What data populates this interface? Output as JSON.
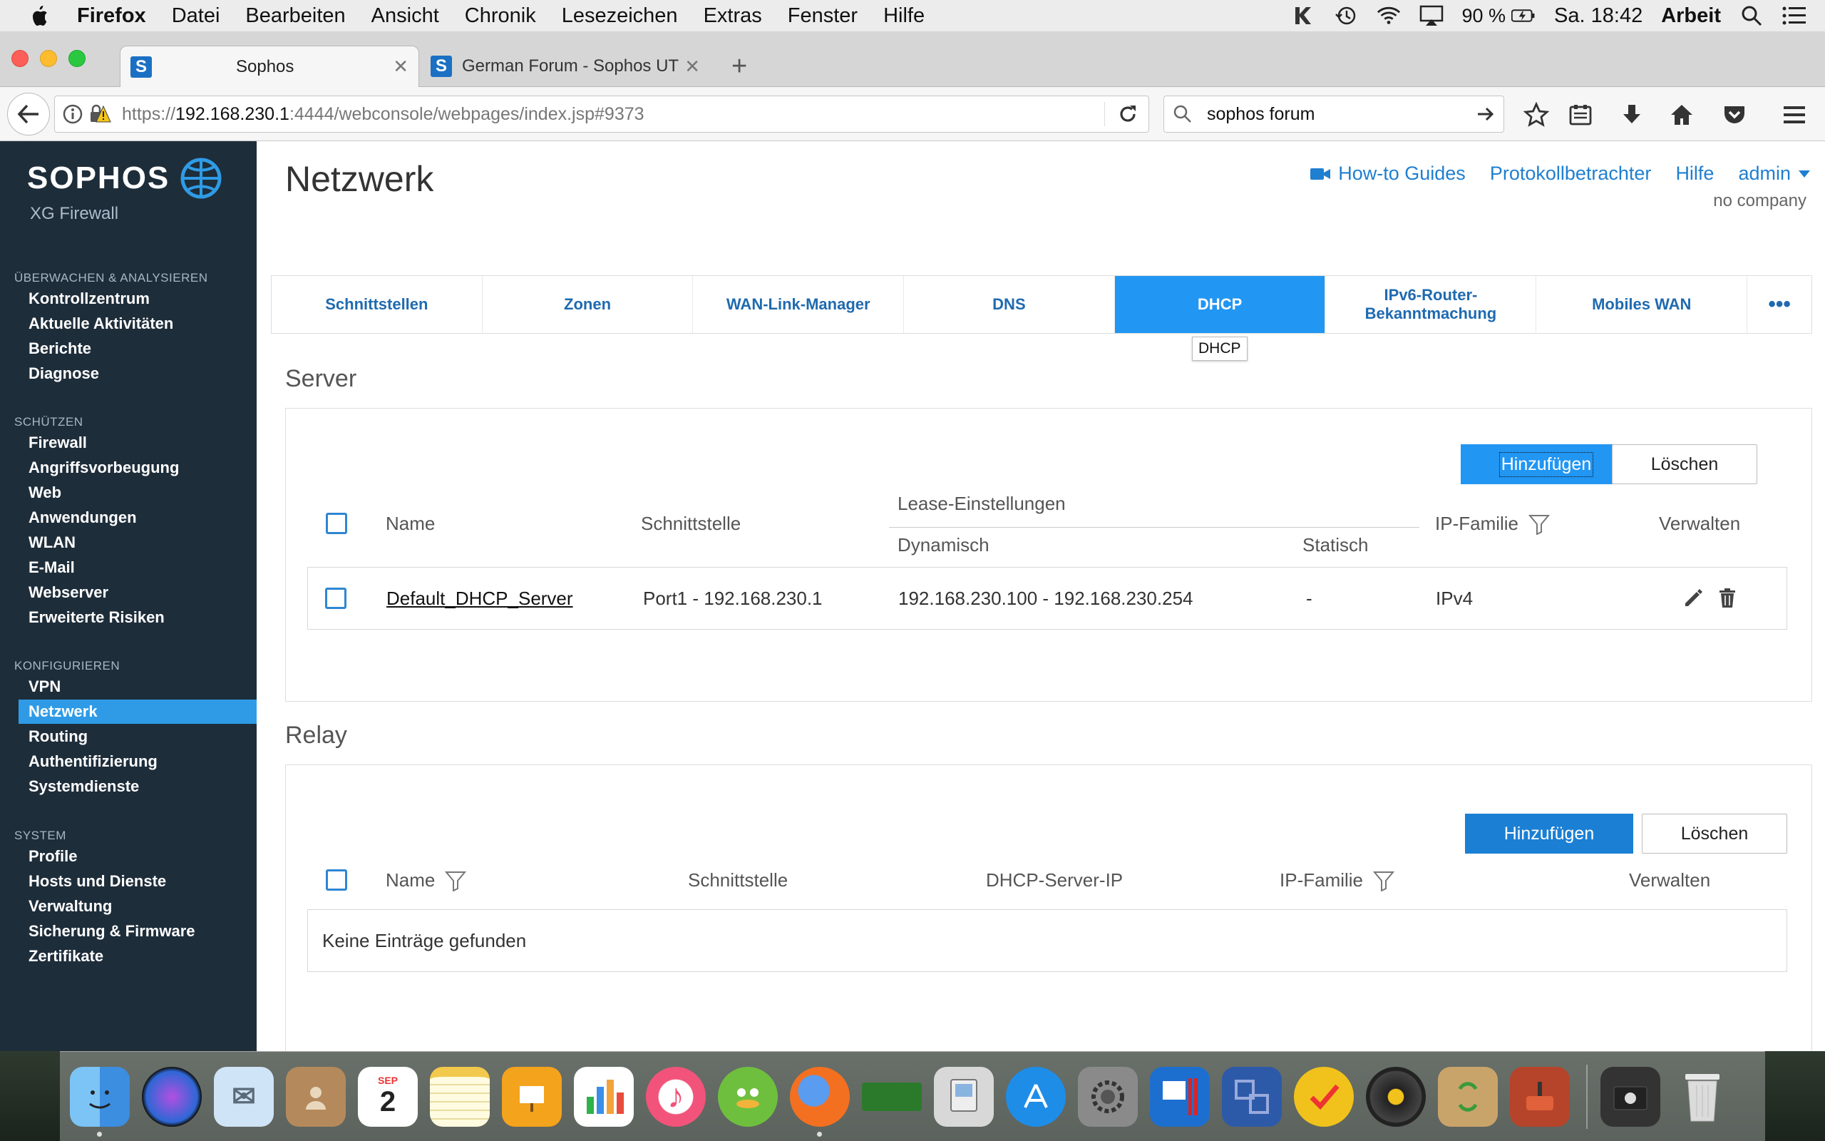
{
  "menubar": {
    "app": "Firefox",
    "items": [
      "Datei",
      "Bearbeiten",
      "Ansicht",
      "Chronik",
      "Lesezeichen",
      "Extras",
      "Fenster",
      "Hilfe"
    ],
    "battery": "90 %",
    "clock": "Sa. 18:42",
    "user": "Arbeit"
  },
  "browser": {
    "tabs": [
      {
        "title": "Sophos",
        "favicon": "S"
      },
      {
        "title": "German Forum - Sophos UTM",
        "favicon": "S"
      }
    ],
    "new_tab": "+",
    "url_prefix": "https://",
    "url_host": "192.168.230.1",
    "url_rest": ":4444/webconsole/webpages/index.jsp#9373",
    "search_value": "sophos forum"
  },
  "sidebar": {
    "logo": "SOPHOS",
    "product": "XG Firewall",
    "sections": [
      {
        "title": "ÜBERWACHEN & ANALYSIEREN",
        "items": [
          "Kontrollzentrum",
          "Aktuelle Aktivitäten",
          "Berichte",
          "Diagnose"
        ]
      },
      {
        "title": "SCHÜTZEN",
        "items": [
          "Firewall",
          "Angriffsvorbeugung",
          "Web",
          "Anwendungen",
          "WLAN",
          "E-Mail",
          "Webserver",
          "Erweiterte Risiken"
        ]
      },
      {
        "title": "KONFIGURIEREN",
        "items": [
          "VPN",
          "Netzwerk",
          "Routing",
          "Authentifizierung",
          "Systemdienste"
        ]
      },
      {
        "title": "SYSTEM",
        "items": [
          "Profile",
          "Hosts und Dienste",
          "Verwaltung",
          "Sicherung & Firmware",
          "Zertifikate"
        ]
      }
    ],
    "active_item": "Netzwerk"
  },
  "header": {
    "title": "Netzwerk",
    "links": {
      "howto": "How-to Guides",
      "log": "Protokollbetrachter",
      "help": "Hilfe",
      "admin": "admin"
    },
    "company": "no company"
  },
  "tabs": {
    "items": [
      "Schnittstellen",
      "Zonen",
      "WAN-Link-Manager",
      "DNS",
      "DHCP",
      "IPv6-Router-Bekanntmachung",
      "Mobiles WAN"
    ],
    "more": "•••",
    "active": "DHCP",
    "tooltip": "DHCP"
  },
  "server": {
    "title": "Server",
    "add": "Hinzufügen",
    "delete": "Löschen",
    "columns": {
      "name": "Name",
      "interface": "Schnittstelle",
      "lease": "Lease-Einstellungen",
      "dynamic": "Dynamisch",
      "static": "Statisch",
      "family": "IP-Familie",
      "manage": "Verwalten"
    },
    "rows": [
      {
        "name": "Default_DHCP_Server",
        "interface": "Port1 - 192.168.230.1",
        "dynamic": "192.168.230.100 - 192.168.230.254",
        "static": "-",
        "family": "IPv4"
      }
    ]
  },
  "relay": {
    "title": "Relay",
    "add": "Hinzufügen",
    "delete": "Löschen",
    "columns": {
      "name": "Name",
      "interface": "Schnittstelle",
      "server_ip": "DHCP-Server-IP",
      "family": "IP-Familie",
      "manage": "Verwalten"
    },
    "empty": "Keine Einträge gefunden"
  },
  "colors": {
    "sidebar_bg": "#1e2d3a",
    "accent": "#2196f3",
    "link": "#1f7fd0"
  }
}
